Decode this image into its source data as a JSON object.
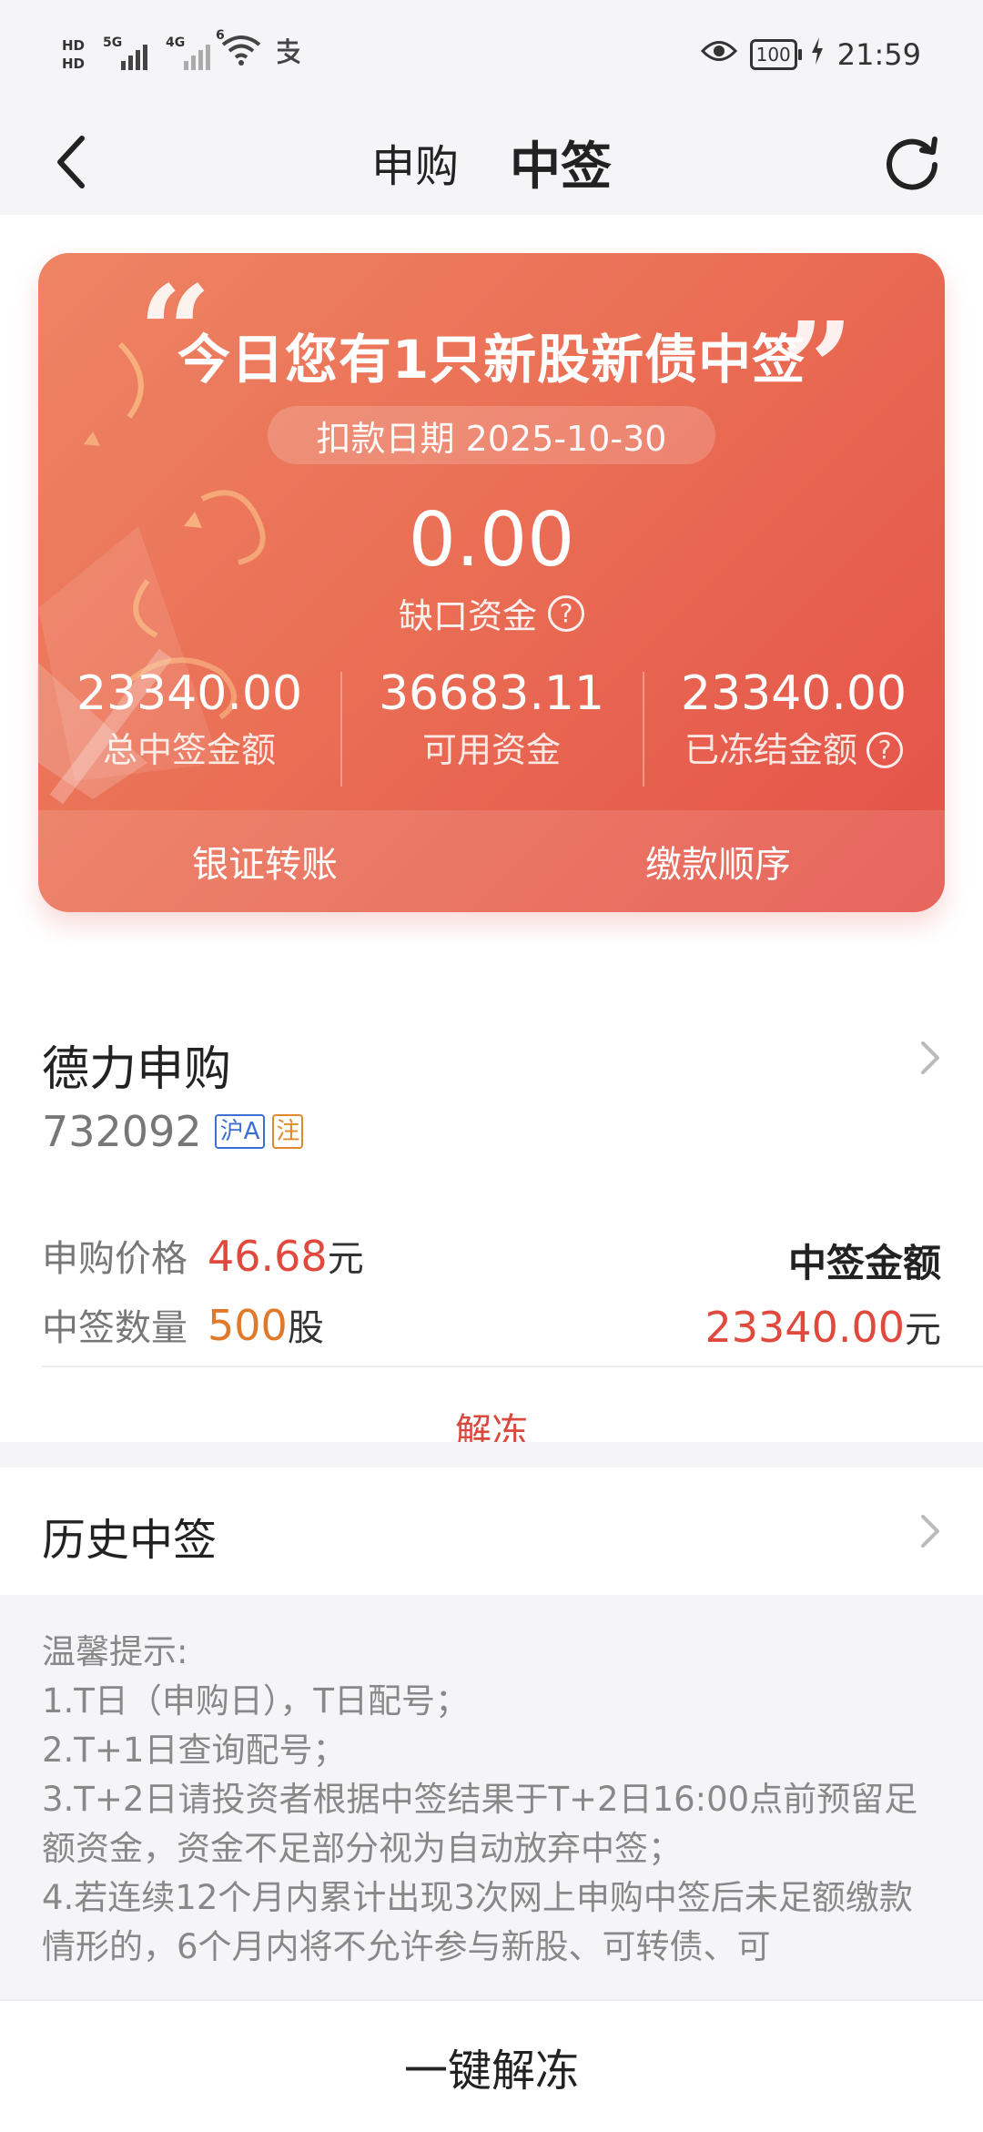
{
  "status_bar": {
    "hd1": "HD",
    "hd2": "HD",
    "net1": "5G",
    "net2": "4G",
    "wifi_tag": "6",
    "battery": "100",
    "time": "21:59"
  },
  "nav": {
    "tab_apply": "申购",
    "tab_win": "中签"
  },
  "summary": {
    "headline": "今日您有1只新股新债中签",
    "date_text": "扣款日期 2025-10-30",
    "gap_value": "0.00",
    "gap_label": "缺口资金",
    "stats": [
      {
        "value": "23340.00",
        "label": "总中签金额"
      },
      {
        "value": "36683.11",
        "label": "可用资金"
      },
      {
        "value": "23340.00",
        "label": "已冻结金额"
      }
    ],
    "actions": [
      "银证转账",
      "缴款顺序"
    ]
  },
  "stock": {
    "name": "德力申购",
    "code": "732092",
    "market_badge": "沪A",
    "reg_badge": "注",
    "price_label": "申购价格",
    "price": "46.68",
    "price_unit": "元",
    "qty_label": "中签数量",
    "qty": "500",
    "qty_unit": "股",
    "amount_label": "中签金额",
    "amount": "23340.00",
    "amount_unit": "元",
    "unfreeze": "解冻"
  },
  "history": {
    "label": "历史中签"
  },
  "tips": {
    "title": "温馨提示:",
    "lines": [
      "1.T日（申购日），T日配号；",
      "2.T+1日查询配号；",
      "3.T+2日请投资者根据中签结果于T+2日16:00点前预留足额资金，资金不足部分视为自动放弃中签；",
      "4.若连续12个月内累计出现3次网上申购中签后未足额缴款情形的，6个月内将不允许参与新股、可转债、可"
    ]
  },
  "bottom": {
    "button": "一键解冻"
  },
  "colors": {
    "accent_red": "#e04a3e",
    "accent_orange": "#e07a2a",
    "card_gradient_start": "#ee8464",
    "card_gradient_end": "#e45148"
  }
}
